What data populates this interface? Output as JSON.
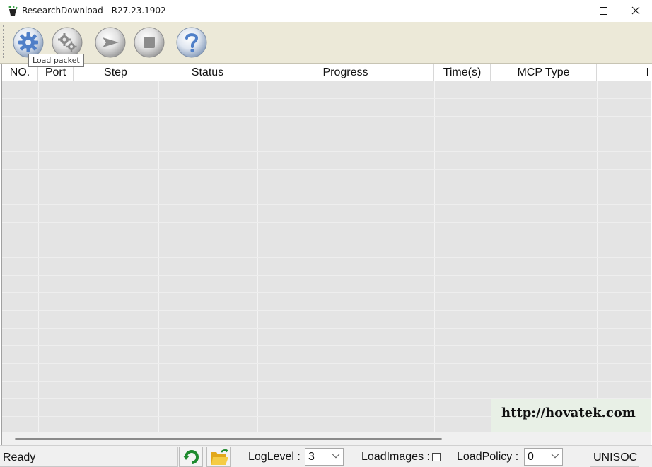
{
  "window": {
    "title": "ResearchDownload - R27.23.1902",
    "controls": [
      "minimize",
      "maximize",
      "close"
    ]
  },
  "toolbar": {
    "buttons": [
      {
        "name": "load-packet-button",
        "icon": "gear-icon"
      },
      {
        "name": "settings-button",
        "icon": "gears-icon"
      },
      {
        "name": "start-button",
        "icon": "play-arrow-icon"
      },
      {
        "name": "stop-button",
        "icon": "stop-square-icon"
      },
      {
        "name": "help-button",
        "icon": "question-mark-icon"
      }
    ],
    "tooltip": "Load packet"
  },
  "grid": {
    "columns": [
      "NO.",
      "Port",
      "Step",
      "Status",
      "Progress",
      "Time(s)",
      "MCP Type",
      "I"
    ],
    "rows": []
  },
  "watermark": "http://hovatek.com",
  "statusbar": {
    "status": "Ready",
    "refresh_icon": "refresh-arrow-icon",
    "folder_icon": "open-folder-icon",
    "log_level_label": "LogLevel :",
    "log_level_value": "3",
    "load_images_label": "LoadImages :",
    "load_images_checked": false,
    "load_policy_label": "LoadPolicy :",
    "load_policy_value": "0",
    "brand": "UNISOC"
  },
  "colors": {
    "toolbar_bg": "#ece9d8",
    "grid_bg": "#e4e4e4",
    "watermark_bg": "#e8f0e6",
    "button_blue": "#5a86c8",
    "button_gray": "#9a9a9a"
  }
}
